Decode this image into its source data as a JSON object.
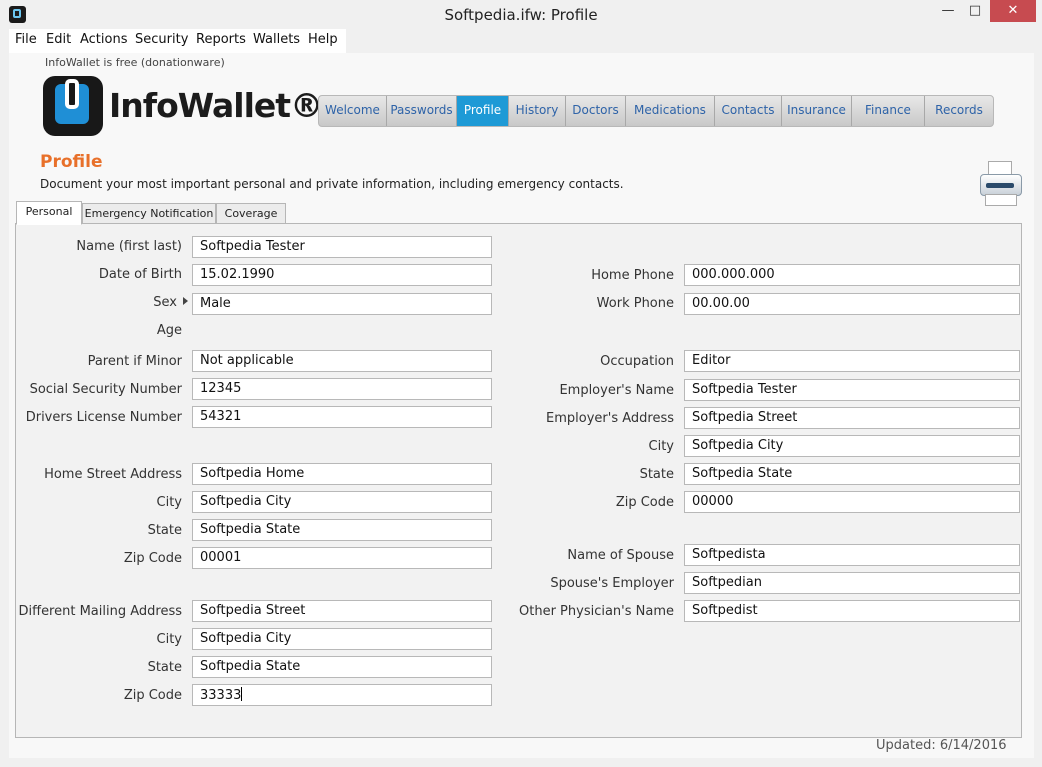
{
  "window": {
    "title": "Softpedia.ifw: Profile",
    "min": "—",
    "max": "□",
    "close": "✕"
  },
  "menu": [
    "File",
    "Edit",
    "Actions",
    "Security",
    "Reports",
    "Wallets",
    "Help"
  ],
  "freeware_note": "InfoWallet is free (donationware)",
  "logo_text": "InfoWallet®",
  "nav_tabs": [
    "Welcome",
    "Passwords",
    "Profile",
    "History",
    "Doctors",
    "Medications",
    "Contacts",
    "Insurance",
    "Finance",
    "Records"
  ],
  "active_nav": "Profile",
  "section": {
    "title": "Profile",
    "description": "Document your most important personal and private information, including emergency contacts."
  },
  "subtabs": [
    "Personal",
    "Emergency Notification",
    "Coverage"
  ],
  "left_fields": [
    {
      "label": "Name (first last)",
      "value": "Softpedia Tester"
    },
    {
      "label": "Date of Birth",
      "value": "15.02.1990"
    },
    {
      "label": "Sex",
      "value": "Male"
    },
    {
      "label": "Age",
      "value": ""
    },
    {
      "label": "Parent if Minor",
      "value": "Not applicable"
    },
    {
      "label": "Social Security Number",
      "value": "12345"
    },
    {
      "label": "Drivers License Number",
      "value": "54321"
    },
    {
      "label": "Home Street Address",
      "value": "Softpedia Home"
    },
    {
      "label": "City",
      "value": "Softpedia City"
    },
    {
      "label": "State",
      "value": "Softpedia State"
    },
    {
      "label": "Zip Code",
      "value": "00001"
    },
    {
      "label": "Different Mailing Address",
      "value": "Softpedia Street"
    },
    {
      "label": "City",
      "value": "Softpedia City"
    },
    {
      "label": "State",
      "value": "Softpedia State"
    },
    {
      "label": "Zip Code",
      "value": "33333"
    }
  ],
  "right_fields": [
    {
      "label": "Home Phone",
      "value": "000.000.000"
    },
    {
      "label": "Work Phone",
      "value": "00.00.00"
    },
    {
      "label": "Occupation",
      "value": "Editor"
    },
    {
      "label": "Employer's Name",
      "value": "Softpedia Tester"
    },
    {
      "label": "Employer's Address",
      "value": "Softpedia Street"
    },
    {
      "label": "City",
      "value": "Softpedia City"
    },
    {
      "label": "State",
      "value": "Softpedia State"
    },
    {
      "label": "Zip Code",
      "value": "00000"
    },
    {
      "label": "Name of Spouse",
      "value": "Softpedista"
    },
    {
      "label": "Spouse's Employer",
      "value": "Softpedian"
    },
    {
      "label": "Other Physician's Name",
      "value": "Softpedist"
    }
  ],
  "updated": "Updated: 6/14/2016"
}
